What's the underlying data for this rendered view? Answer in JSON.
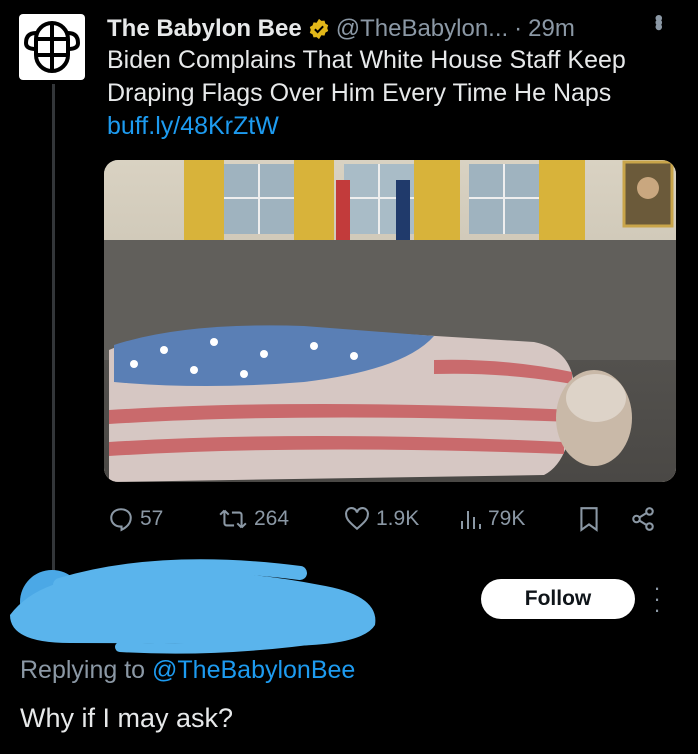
{
  "tweet": {
    "author_name": "The Babylon Bee",
    "author_handle": "@TheBabylon...",
    "separator": "·",
    "time": "29m",
    "text": "Biden Complains That White House Staff Keep Draping Flags Over Him Every Time He Naps",
    "link": "buff.ly/48KrZtW",
    "avatar_icon": "bee-logo-icon",
    "verified_icon": "verified-badge-icon",
    "verified_color": "#e2b719",
    "media_icon": "photo-oval-office-icon"
  },
  "actions": {
    "replies": "57",
    "retweets": "264",
    "likes": "1.9K",
    "views": "79K",
    "reply_icon": "reply-icon",
    "retweet_icon": "retweet-icon",
    "like_icon": "heart-icon",
    "views_icon": "views-chart-icon",
    "bookmark_icon": "bookmark-icon",
    "share_icon": "share-icon"
  },
  "reply": {
    "follow_label": "Follow",
    "replying_prefix": "Replying to",
    "replying_to": "@TheBabylonBee",
    "text": "Why if I may ask?",
    "redaction_color": "#5ab4ec"
  },
  "colors": {
    "background": "#000000",
    "link": "#1d9bf0",
    "muted": "#8b98a5"
  }
}
